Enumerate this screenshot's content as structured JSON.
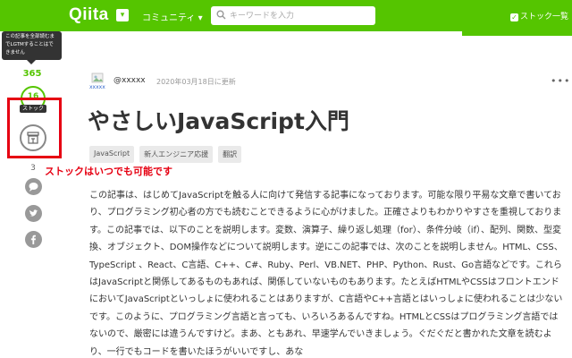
{
  "header": {
    "logo": "Qiita",
    "community_label": "コミュニティ ▾",
    "search_placeholder": "キーワードを入力",
    "stock_list_label": "ストック一覧",
    "accent_color": "#55c500"
  },
  "tooltip": {
    "lines": [
      "この記事を全部読むま",
      "でLGTMすることはで",
      "きません"
    ]
  },
  "sidebar": {
    "like_count": "365",
    "stock_number": "16",
    "stock_badge": "ストック",
    "stock_count": "3",
    "icons": [
      "stock-icon",
      "comment-icon",
      "twitter-icon",
      "facebook-icon"
    ]
  },
  "annotation": {
    "note": "ストックはいつでも可能です",
    "color": "#e60012"
  },
  "article": {
    "avatar_alt": "xxxxx",
    "username": "@xxxxx",
    "date": "2020年03月18日に更新",
    "more": "•••",
    "title": "やさしいJavaScript入門",
    "tags": [
      "JavaScript",
      "新人エンジニア応援",
      "翻訳"
    ],
    "body": "この記事は、はじめてJavaScriptを触る人に向けて発信する記事になっております。可能な限り平易な文章で書いており、プログラミング初心者の方でも読むことできるように心がけました。正確さよりもわかりやすさを重視しております。この記事では、以下のことを説明します。変数、演算子、繰り返し処理（for）、条件分岐（if）、配列、関数、型変換、オブジェクト、DOM操作などについて説明します。逆にこの記事では、次のことを説明しません。HTML、CSS、TypeScript 、React、C言語、C++、C#、Ruby、Perl、VB.NET、PHP、Python、Rust、Go言語などです。これらはJavaScriptと関係してあるものもあれば、関係していないものもあります。たとえばHTMLやCSSはフロントエンドにおいてJavaScriptといっしょに使われることはありますが、C言語やC++言語とはいっしょに使われることは少ないです。このように、プログラミング言語と言っても、いろいろあるんですね。HTMLとCSSはプログラミング言語ではないので、厳密には違うんですけど。まあ、ともあれ、早速学んでいきましょう。ぐだぐだと書かれた文章を読むより、一行でもコードを書いたほうがいいですし、あな"
  }
}
